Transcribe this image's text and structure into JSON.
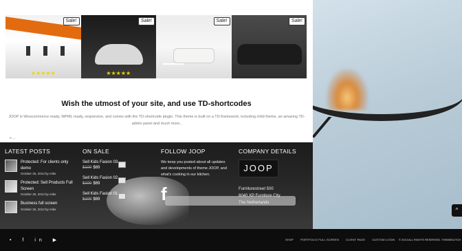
{
  "gallery": {
    "sale_badge": "Sale!",
    "stars": "★★★★★"
  },
  "content": {
    "headline": "Wish the utmost of your site, and use TD-shortcodes",
    "intro": "JOOP is Woocommerce ready, WPML ready, responsive, and comes with the TD-shortcode plugin. This theme is built on a TD-framework, including child theme, an amazing TD-admin panel and much more..",
    "breadcrumb": "» ..."
  },
  "widgets": {
    "latest_posts": {
      "heading": "LATEST POSTS",
      "items": [
        {
          "title": "Protected: For clients only demo",
          "date": "October 25, 2013 by  mike"
        },
        {
          "title": "Protected: Sell Products Full Screen",
          "date": "October 25, 2013 by  mike"
        },
        {
          "title": "Business full screen",
          "date": "October 25, 2013 by  mike"
        }
      ]
    },
    "on_sale": {
      "heading": "ON SALE",
      "items": [
        {
          "name": "Sell Kids Fasion 03",
          "old_price": "$100",
          "price": "$69"
        },
        {
          "name": "Sell Kids Fasion 02",
          "old_price": "$100",
          "price": "$69"
        },
        {
          "name": "Sell Kids Fasion 01",
          "old_price": "$100",
          "price": "$69"
        }
      ]
    },
    "follow": {
      "heading": "FOLLOW JOOP",
      "text": "We keep you posted about all updates and developments of theme JOOP, and what's cooking in our kitchen.",
      "facebook_glyph": "f"
    },
    "company": {
      "heading": "COMPANY DETAILS",
      "logo": "JOOP",
      "address_1": "Furniturestreet 500",
      "address_2": "6040 XP Furniture City",
      "address_3": "The Netherlands"
    }
  },
  "footer": {
    "social": [
      "twitter-icon",
      "facebook-icon",
      "linkedin-icon",
      "youtube-icon"
    ],
    "social_glyphs": [
      "•",
      "f",
      "in",
      "▶"
    ],
    "menu": [
      "SHOP",
      "PORTFOLIO FULL SCREEN",
      "CLIENT PAGE",
      "CUSTOM LOGIN"
    ],
    "copyright": "© 2013 ALL RIGHTS RESERVED. THEMEDUTCH"
  },
  "scroll_top_glyph": "^"
}
